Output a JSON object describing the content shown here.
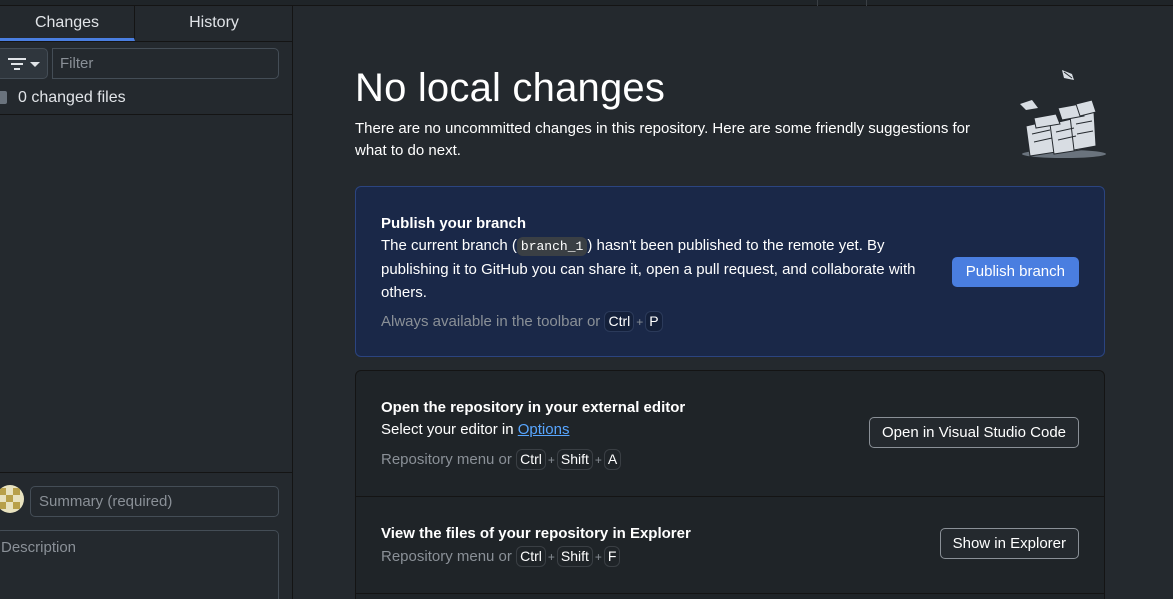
{
  "tabs": {
    "changes": "Changes",
    "history": "History"
  },
  "sidebar": {
    "filter_placeholder": "Filter",
    "changed_files": "0 changed files",
    "summary_placeholder": "Summary (required)",
    "description_placeholder": "Description"
  },
  "main": {
    "title": "No local changes",
    "subtitle": "There are no uncommitted changes in this repository. Here are some friendly suggestions for what to do next."
  },
  "publish": {
    "heading": "Publish your branch",
    "text_before": "The current branch (",
    "branch": "branch_1",
    "text_after": ") hasn't been published to the remote yet. By publishing it to GitHub you can share it, open a pull request, and collaborate with others.",
    "hint_prefix": "Always available in the toolbar or",
    "keys": [
      "Ctrl",
      "P"
    ],
    "button": "Publish branch"
  },
  "editor": {
    "heading": "Open the repository in your external editor",
    "text": "Select your editor in",
    "link": "Options",
    "hint_prefix": "Repository menu or",
    "keys": [
      "Ctrl",
      "Shift",
      "A"
    ],
    "button": "Open in Visual Studio Code"
  },
  "explorer": {
    "heading": "View the files of your repository in Explorer",
    "hint_prefix": "Repository menu or",
    "keys": [
      "Ctrl",
      "Shift",
      "F"
    ],
    "button": "Show in Explorer"
  },
  "plus": "+",
  "icons": {
    "filter": "filter-icon",
    "caret": "chevron-down-icon",
    "illustration": "empty-state-illustration"
  },
  "colors": {
    "accent": "#4a7ee0",
    "background": "#24292e",
    "publish_card": "#1a2848",
    "link": "#58a6ff"
  }
}
